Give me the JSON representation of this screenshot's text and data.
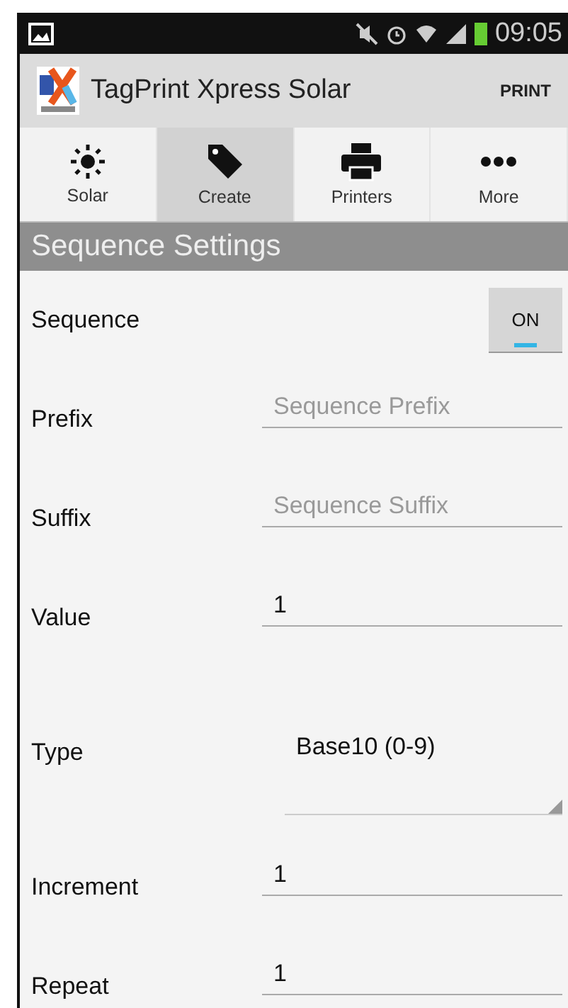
{
  "status_bar": {
    "time": "09:05"
  },
  "action_bar": {
    "title": "TagPrint Xpress Solar",
    "action": "PRINT"
  },
  "tabs": [
    {
      "label": "Solar",
      "selected": false
    },
    {
      "label": "Create",
      "selected": true
    },
    {
      "label": "Printers",
      "selected": false
    },
    {
      "label": "More",
      "selected": false
    }
  ],
  "section": {
    "title": "Sequence Settings"
  },
  "settings": [
    {
      "kind": "toggle",
      "label": "Sequence",
      "value": "ON",
      "on": true
    },
    {
      "kind": "text",
      "label": "Prefix",
      "placeholder": "Sequence Prefix"
    },
    {
      "kind": "text",
      "label": "Suffix",
      "placeholder": "Sequence Suffix"
    },
    {
      "kind": "text",
      "label": "Value",
      "value": "1"
    },
    {
      "kind": "dropdown",
      "label": "Type",
      "value": "Base10 (0-9)"
    },
    {
      "kind": "text",
      "label": "Increment",
      "value": "1"
    },
    {
      "kind": "text",
      "label": "Repeat",
      "value": "1"
    }
  ]
}
